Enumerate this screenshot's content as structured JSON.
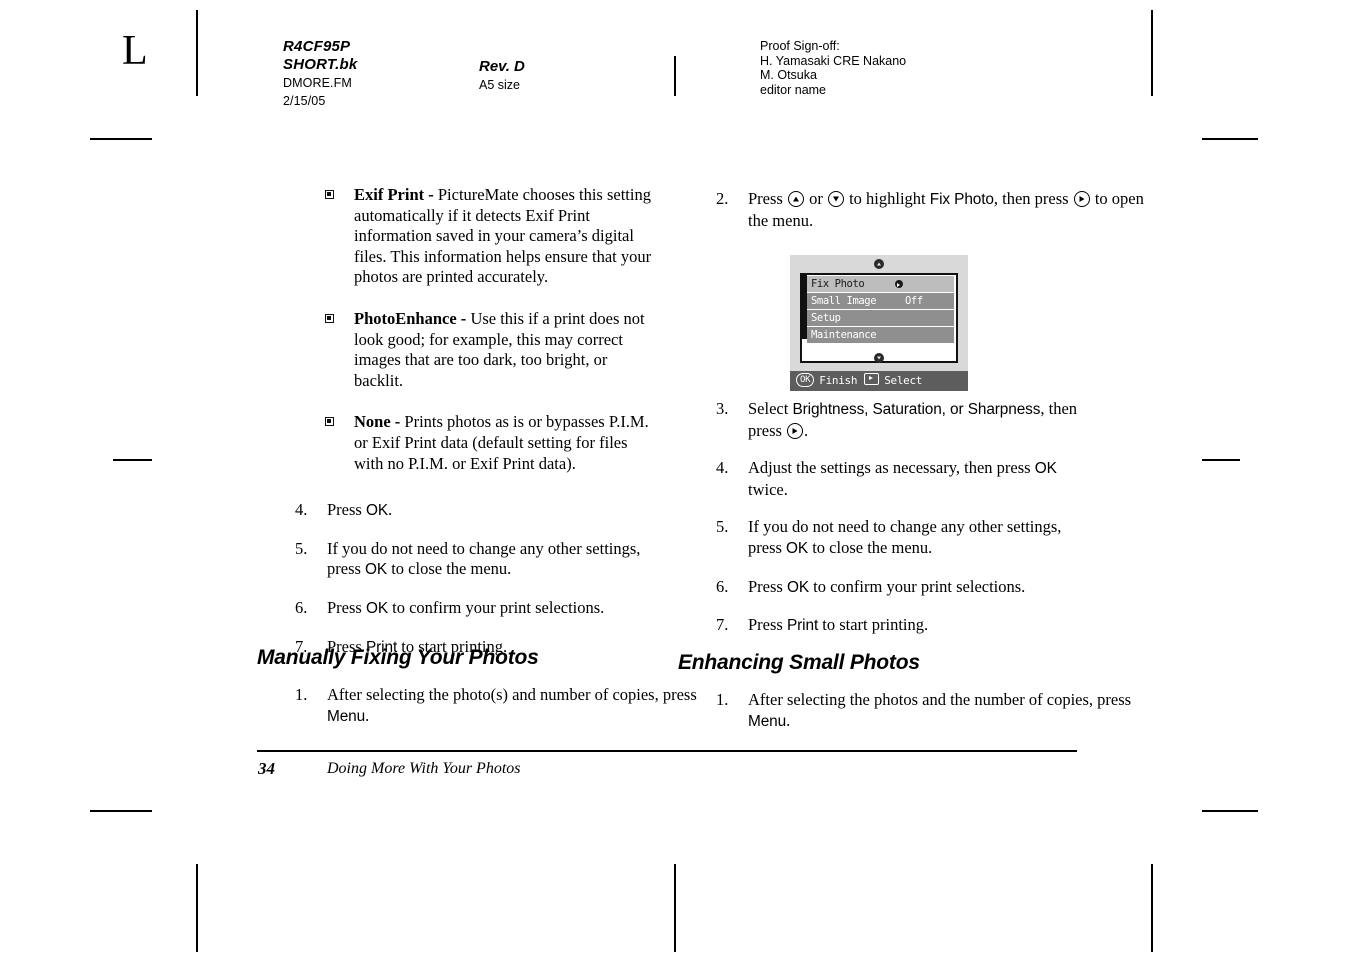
{
  "header": {
    "margin_letter": "L",
    "doc_name_line1": "R4CF95P",
    "doc_name_line2": "SHORT.bk",
    "file_name": "DMORE.FM",
    "date": "2/15/05",
    "rev": "Rev. D",
    "size": "A5 size",
    "signoff_label": "Proof Sign-off:",
    "signoff_line1": "H. Yamasaki CRE Nakano",
    "signoff_line2": "M. Otsuka",
    "signoff_line3": "editor name"
  },
  "left_column": {
    "bullets": [
      {
        "term": "Exif Print - ",
        "text": "PictureMate chooses this setting automatically if it detects Exif Print information saved in your camera’s digital files. This information helps ensure that your photos are printed accurately."
      },
      {
        "term": "PhotoEnhance - ",
        "text": "Use this if a print does not look good; for example, this may correct images that are too dark, too bright, or backlit."
      },
      {
        "term": "None - ",
        "text": "Prints photos as is or bypasses P.I.M. or Exif Print data (default setting for files with no P.I.M. or Exif Print data)."
      }
    ],
    "steps": [
      {
        "num": "4.",
        "pre": "Press ",
        "ui": "OK",
        "post": "."
      },
      {
        "num": "5.",
        "pre": "If you do not need to change any other settings, press ",
        "ui": "OK",
        "post": " to close the menu."
      },
      {
        "num": "6.",
        "pre": "Press ",
        "ui": "OK",
        "post": " to confirm your print selections."
      },
      {
        "num": "7.",
        "pre": "Press ",
        "ui": "Print",
        "post": " to start printing."
      }
    ],
    "heading": "Manually Fixing Your Photos",
    "step1": {
      "num": "1.",
      "pre": "After selecting the photo(s) and number of copies, press ",
      "ui": "Menu",
      "post": "."
    }
  },
  "right_column": {
    "step2": {
      "num": "2.",
      "part1": "Press ",
      "icon1": "arrow-up-button-icon",
      "part2": " or ",
      "icon2": "arrow-down-button-icon",
      "part3": " to highlight ",
      "ui1": "Fix Photo",
      "part4": ", then press ",
      "icon3": "arrow-right-button-icon",
      "part5": " to open the menu."
    },
    "lcd": {
      "rows": [
        {
          "label": "Fix Photo",
          "value": "",
          "has_submenu_icon": true,
          "selected": true
        },
        {
          "label": "Small Image",
          "value": "Off",
          "has_submenu_icon": false,
          "selected": false
        },
        {
          "label": "Setup",
          "value": "",
          "has_submenu_icon": false,
          "selected": false
        },
        {
          "label": "Maintenance",
          "value": "",
          "has_submenu_icon": false,
          "selected": false
        }
      ],
      "bar_ok": "OK",
      "bar_ok_label": "Finish",
      "bar_play_label": "Select"
    },
    "steps": [
      {
        "num": "3.",
        "pre": "Select ",
        "ui": "Brightness, Saturation, or Sharpness",
        "post": ", then press ",
        "icon": "arrow-right-button-icon",
        "tail": "."
      },
      {
        "num": "4.",
        "pre": "Adjust the settings as necessary, then press ",
        "ui": "OK",
        "post": " twice."
      },
      {
        "num": "5.",
        "pre": "If you do not need to change any other settings, press ",
        "ui": "OK",
        "post": " to close the menu."
      },
      {
        "num": "6.",
        "pre": "Press ",
        "ui": "OK",
        "post": " to confirm your print selections."
      },
      {
        "num": "7.",
        "pre": "Press ",
        "ui": "Print",
        "post": " to start printing."
      }
    ],
    "heading": "Enhancing Small Photos",
    "step1": {
      "num": "1.",
      "pre": "After selecting the photos and the number of copies, press ",
      "ui": "Menu",
      "post": "."
    }
  },
  "footer": {
    "page_number": "34",
    "title": "Doing More With Your Photos"
  }
}
